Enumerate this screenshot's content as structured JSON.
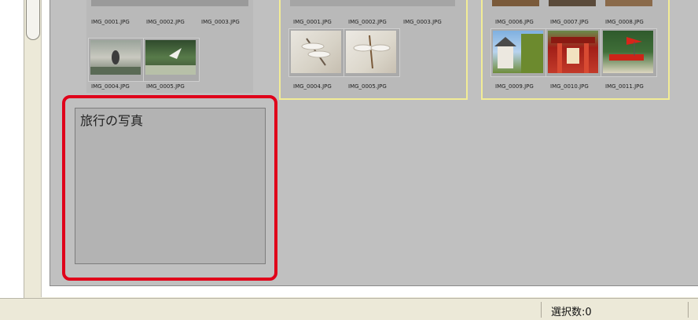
{
  "groups": [
    {
      "selected": false,
      "thumbs": [
        {
          "label": "IMG_0001.JPG"
        },
        {
          "label": "IMG_0002.JPG"
        },
        {
          "label": "IMG_0003.JPG"
        },
        {
          "label": "IMG_0004.JPG"
        },
        {
          "label": "IMG_0005.JPG"
        }
      ]
    },
    {
      "selected": true,
      "thumbs": [
        {
          "label": "IMG_0001.JPG"
        },
        {
          "label": "IMG_0002.JPG"
        },
        {
          "label": "IMG_0003.JPG"
        },
        {
          "label": "IMG_0004.JPG"
        },
        {
          "label": "IMG_0005.JPG"
        }
      ]
    },
    {
      "selected": true,
      "thumbs": [
        {
          "label": "IMG_0006.JPG"
        },
        {
          "label": "IMG_0007.JPG"
        },
        {
          "label": "IMG_0008.JPG"
        },
        {
          "label": "IMG_0009.JPG"
        },
        {
          "label": "IMG_0010.JPG"
        },
        {
          "label": "IMG_0011.JPG"
        }
      ]
    }
  ],
  "memo": {
    "text": "旅行の写真"
  },
  "status": {
    "selection_count": "選択数:0"
  },
  "colors": {
    "highlight": "#e0001a",
    "selected_border": "#f2ec96",
    "canvas": "#c0c0c0"
  }
}
